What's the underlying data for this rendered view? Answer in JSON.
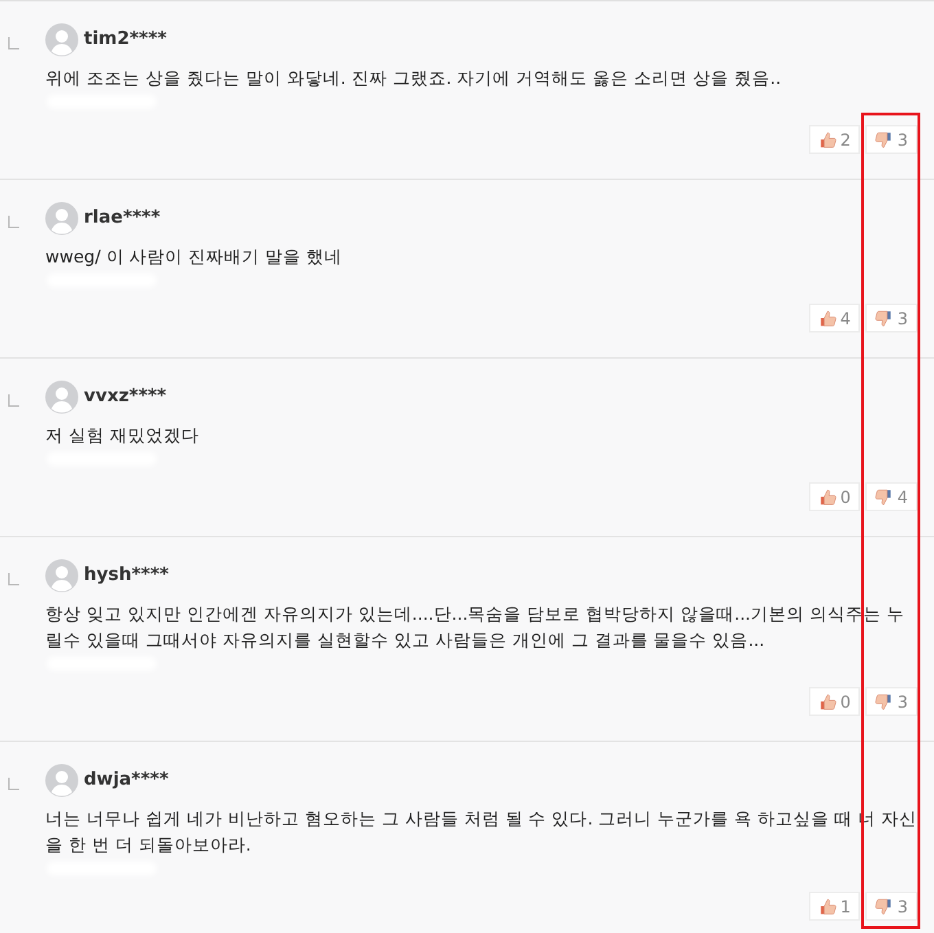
{
  "comments": [
    {
      "user": "tim2****",
      "text": "위에 조조는 상을 줬다는 말이 와닿네. 진짜 그랬죠. 자기에 거역해도 옳은 소리면 상을 줬음..",
      "likes": "2",
      "dislikes": "3"
    },
    {
      "user": "rlae****",
      "text": "wweg/ 이 사람이 진짜배기 말을 했네",
      "likes": "4",
      "dislikes": "3"
    },
    {
      "user": "vvxz****",
      "text": "저 실험 재밌었겠다",
      "likes": "0",
      "dislikes": "4"
    },
    {
      "user": "hysh****",
      "text": "항상 잊고 있지만 인간에겐 자유의지가 있는데....단...목숨을 담보로 협박당하지 않을때...기본의 의식주는 누릴수 있을때 그때서야 자유의지를 실현할수 있고 사람들은 개인에 그 결과를 물을수 있음...",
      "likes": "0",
      "dislikes": "3"
    },
    {
      "user": "dwja****",
      "text": "너는 너무나 쉽게 네가 비난하고 혐오하는 그 사람들 처럼 될 수 있다. 그러니 누군가를 욕 하고싶을 때 너 자신을 한 번 더 되돌아보아라.",
      "likes": "1",
      "dislikes": "3"
    }
  ]
}
